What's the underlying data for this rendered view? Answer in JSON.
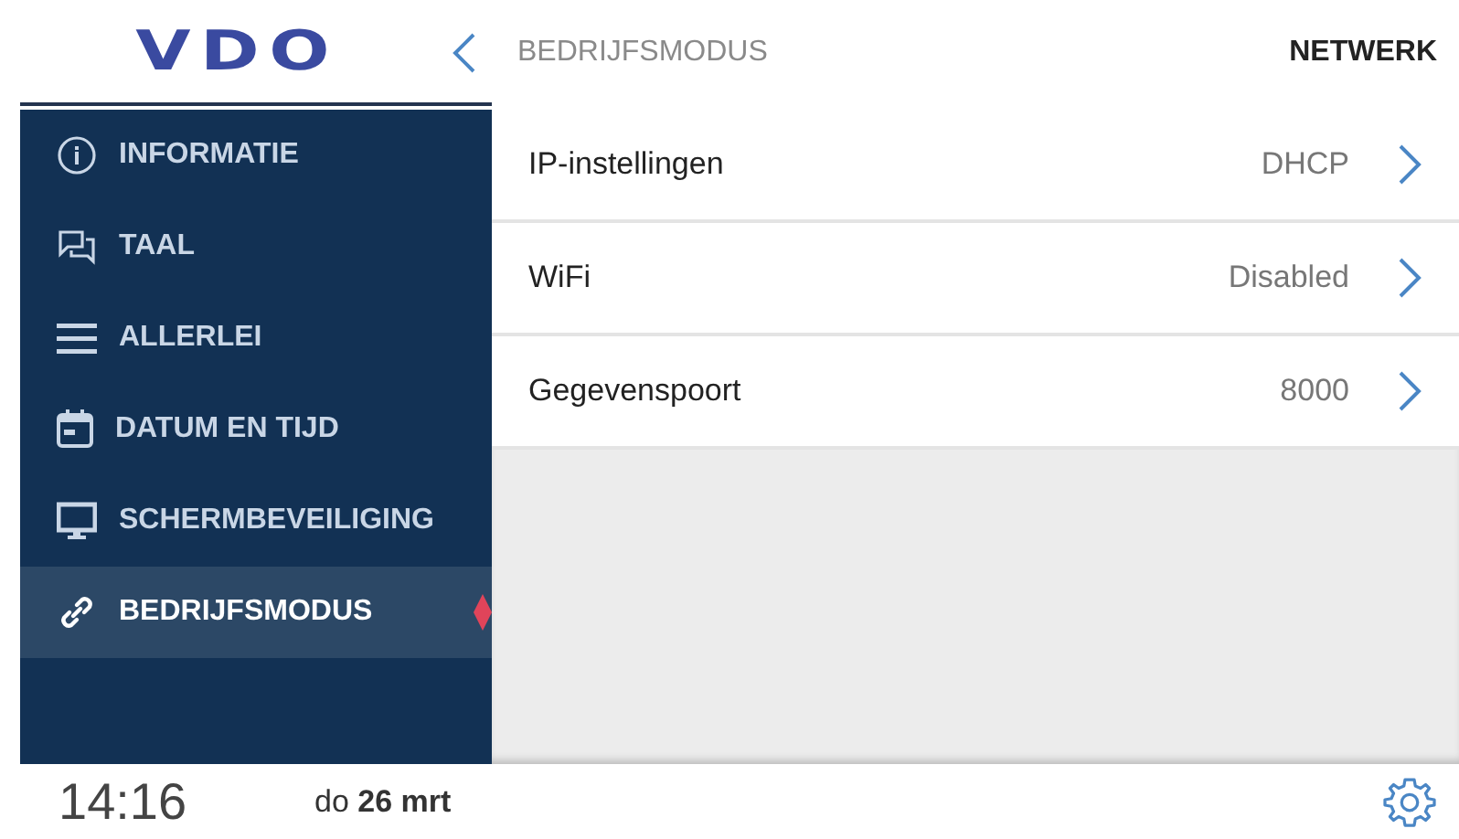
{
  "logo": "VDO",
  "header": {
    "title": "BEDRIJFSMODUS",
    "section": "NETWERK"
  },
  "sidebar": {
    "items": [
      {
        "label": "INFORMATIE",
        "kind": "info",
        "selected": false
      },
      {
        "label": "TAAL",
        "kind": "chat",
        "selected": false
      },
      {
        "label": "ALLERLEI",
        "kind": "menu",
        "selected": false
      },
      {
        "label": "DATUM EN TIJD",
        "kind": "calendar",
        "selected": false
      },
      {
        "label": "SCHERMBEVEILIGING",
        "kind": "monitor",
        "selected": false
      },
      {
        "label": "BEDRIJFSMODUS",
        "kind": "link",
        "selected": true
      }
    ]
  },
  "settings": [
    {
      "label": "IP-instellingen",
      "value": "DHCP"
    },
    {
      "label": "WiFi",
      "value": "Disabled"
    },
    {
      "label": "Gegevenspoort",
      "value": "8000"
    }
  ],
  "status_bar": {
    "time": "14:16",
    "date": "do **26 mrt**"
  }
}
